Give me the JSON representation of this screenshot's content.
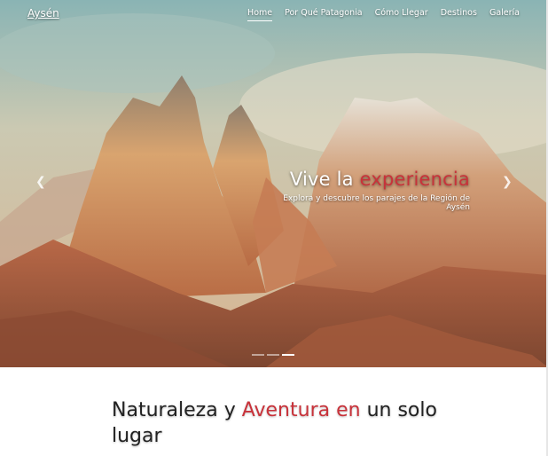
{
  "nav": {
    "brand": "Aysén",
    "items": [
      {
        "label": "Home",
        "active": true
      },
      {
        "label": "Por Qué Patagonia"
      },
      {
        "label": "Cómo Llegar"
      },
      {
        "label": "Destinos"
      },
      {
        "label": "Galería"
      }
    ]
  },
  "hero": {
    "title_plain": "Vive la",
    "title_accent": "experiencia",
    "subtitle": "Explora y descubre los parajes de la Región de Aysén",
    "prev_icon": "chevron-left-icon",
    "next_icon": "chevron-right-icon",
    "slides_total": 3,
    "active_slide": 3
  },
  "section": {
    "title_part1": "Naturaleza y",
    "title_accent": "Aventura en",
    "title_part2": "un solo lugar"
  },
  "colors": {
    "accent": "#c8323a",
    "text": "#222222"
  }
}
